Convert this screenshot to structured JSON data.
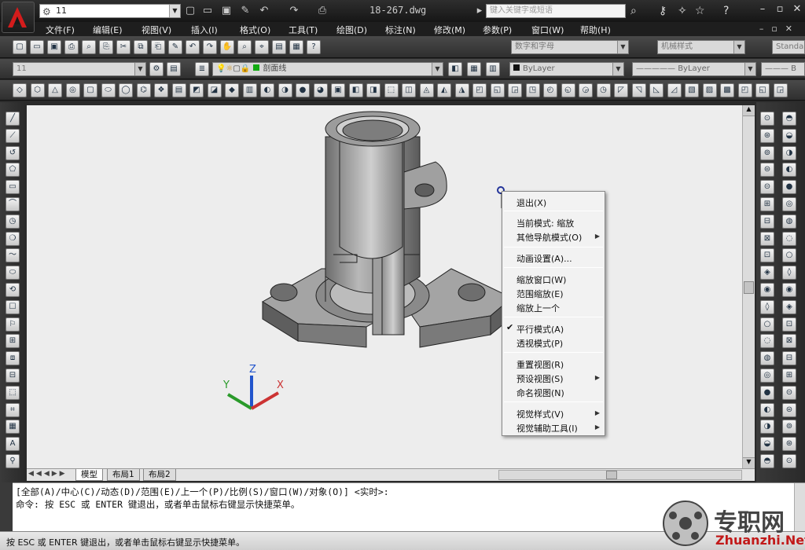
{
  "titlebar": {
    "workspace": "11",
    "doc_title": "18-267.dwg",
    "search_placeholder": "键入关键字或短语"
  },
  "menus": [
    "文件(F)",
    "编辑(E)",
    "视图(V)",
    "插入(I)",
    "格式(O)",
    "工具(T)",
    "绘图(D)",
    "标注(N)",
    "修改(M)",
    "参数(P)",
    "窗口(W)",
    "帮助(H)"
  ],
  "toolbar2": {
    "text_style": "数字和字母",
    "dim_style": "机械样式",
    "table_style": "Standa"
  },
  "toolbar3": {
    "layer_combo": "11",
    "layer_name": "剖面线",
    "color": "ByLayer",
    "linetype": "ByLayer"
  },
  "context_menu": {
    "exit": "退出(X)",
    "current_mode": "当前模式: 缩放",
    "other_nav": "其他导航模式(O)",
    "anim": "动画设置(A)...",
    "zoom_window": "缩放窗口(W)",
    "zoom_extents": "范围缩放(E)",
    "zoom_prev": "缩放上一个",
    "parallel": "平行模式(A)",
    "perspective": "透视模式(P)",
    "reset_view": "重置视图(R)",
    "preset_view": "预设视图(S)",
    "named_view": "命名视图(N)",
    "visual_style": "视觉样式(V)",
    "visual_aids": "视觉辅助工具(I)"
  },
  "tabs": [
    "模型",
    "布局1",
    "布局2"
  ],
  "ucs": {
    "x": "X",
    "y": "Y",
    "z": "Z"
  },
  "command": {
    "line1": "[全部(A)/中心(C)/动态(D)/范围(E)/上一个(P)/比例(S)/窗口(W)/对象(O)] <实时>:",
    "line2": "命令: 按 ESC 或 ENTER 键退出，或者单击鼠标右键显示快捷菜单。"
  },
  "status": "按 ESC 或 ENTER 键退出，或者单击鼠标右键显示快捷菜单。",
  "watermark": {
    "cn": "专职网",
    "url": "Zhuanzhi.Net"
  },
  "colors": {
    "canvas": "#ededed",
    "ucs_x": "#cc3333",
    "ucs_y": "#2a9a2a",
    "ucs_z": "#2255cc"
  }
}
